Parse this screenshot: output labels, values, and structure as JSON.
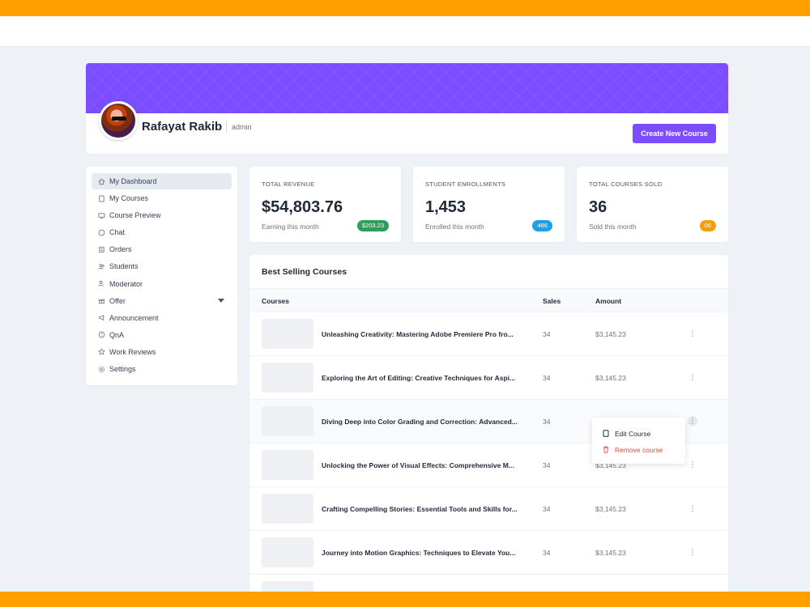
{
  "profile": {
    "name": "Rafayat Rakib",
    "role": "admin",
    "create_button": "Create New Course",
    "brand_color": "#7c4dff"
  },
  "sidebar": {
    "items": [
      {
        "label": "My Dashboard",
        "icon": "home-icon",
        "active": true
      },
      {
        "label": "My Courses",
        "icon": "book-icon"
      },
      {
        "label": "Course Preview",
        "icon": "monitor-icon"
      },
      {
        "label": "Chat",
        "icon": "chat-icon"
      },
      {
        "label": "Orders",
        "icon": "orders-icon"
      },
      {
        "label": "Students",
        "icon": "users-icon"
      },
      {
        "label": "Moderator",
        "icon": "user-shield-icon"
      },
      {
        "label": "Offer",
        "icon": "gift-icon",
        "has_dropdown": true
      },
      {
        "label": "Announcement",
        "icon": "megaphone-icon"
      },
      {
        "label": "QnA",
        "icon": "question-icon"
      },
      {
        "label": "Work Reviews",
        "icon": "star-icon"
      },
      {
        "label": "Settings",
        "icon": "gear-icon"
      }
    ]
  },
  "stats": [
    {
      "label": "TOTAL REVENUE",
      "value": "$54,803.76",
      "sub": "Earning this month",
      "badge": "$203.23",
      "badge_color": "#2f9e5a"
    },
    {
      "label": "STUDENT ENROLLMENTS",
      "value": "1,453",
      "sub": "Enrolled this month",
      "badge": "486",
      "badge_color": "#1ea0e6"
    },
    {
      "label": "TOTAL COURSES SOLD",
      "value": "36",
      "sub": "Sold this month",
      "badge": "06",
      "badge_color": "#f59e0b"
    }
  ],
  "best_selling": {
    "title": "Best Selling Courses",
    "columns": [
      "Courses",
      "Sales",
      "Amount"
    ],
    "rows": [
      {
        "title": "Unleashing Creativity: Mastering Adobe Premiere Pro fro...",
        "sales": "34",
        "amount": "$3,145.23"
      },
      {
        "title": "Exploring the Art of Editing: Creative Techniques for Aspi...",
        "sales": "34",
        "amount": "$3,145.23"
      },
      {
        "title": "Diving Deep into Color Grading and Correction: Advanced...",
        "sales": "34",
        "amount": ""
      },
      {
        "title": "Unlocking the Power of Visual Effects: Comprehensive M...",
        "sales": "34",
        "amount": "$3,145.23"
      },
      {
        "title": "Crafting Compelling Stories: Essential Tools and Skills for...",
        "sales": "34",
        "amount": "$3,145.23"
      },
      {
        "title": "Journey into Motion Graphics: Techniques to Elevate You...",
        "sales": "34",
        "amount": "$3,145.23"
      },
      {
        "title": "",
        "sales": "",
        "amount": ""
      }
    ],
    "row_menu": {
      "edit": "Edit Course",
      "remove": "Remove course"
    }
  }
}
